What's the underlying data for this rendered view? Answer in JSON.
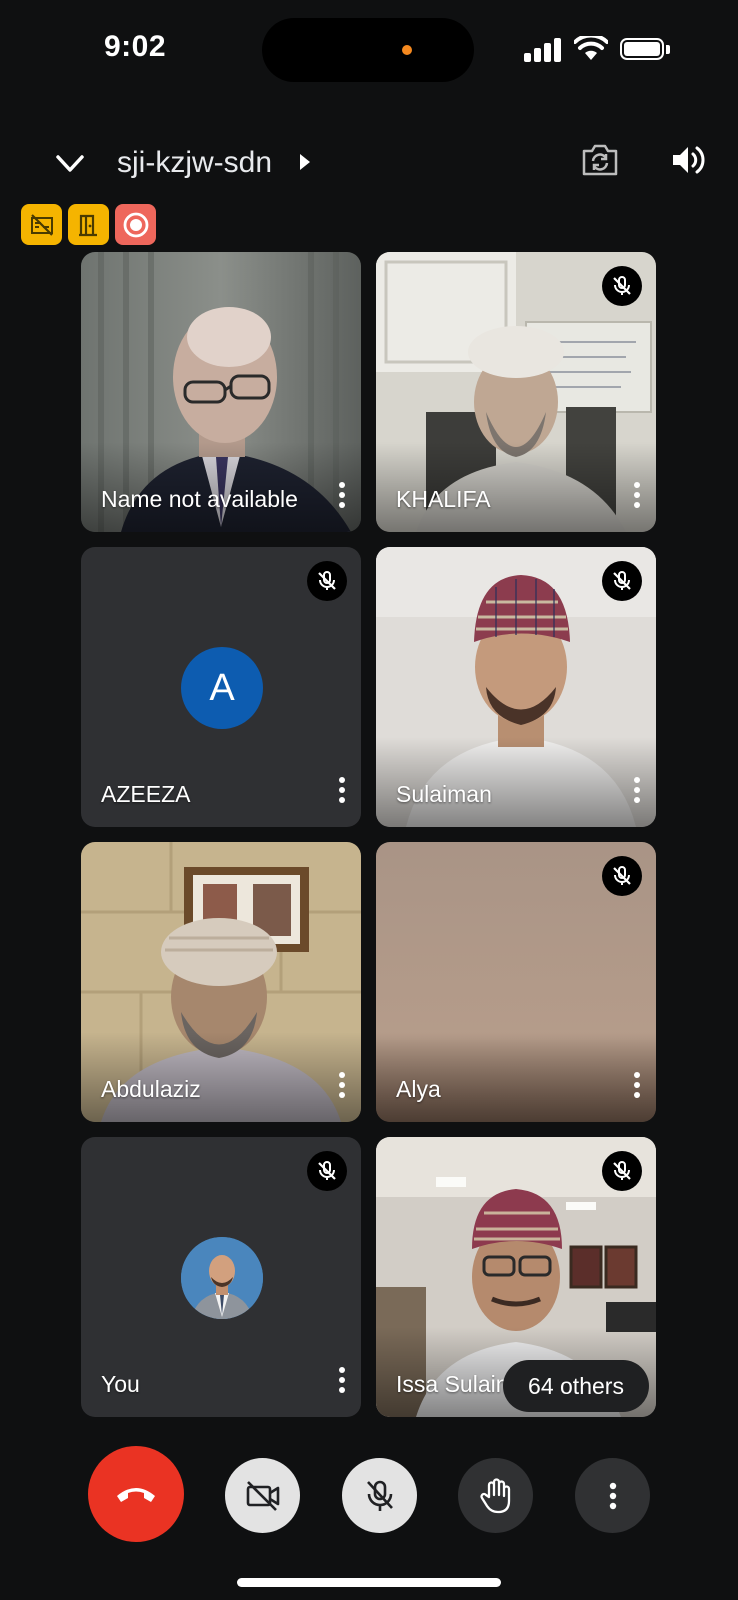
{
  "status_bar": {
    "time": "9:02"
  },
  "meeting": {
    "code": "sji-kzjw-sdn"
  },
  "participants": [
    {
      "name": "Name not available",
      "muted": false
    },
    {
      "name": "KHALIFA",
      "muted": true
    },
    {
      "name": "AZEEZA",
      "muted": true,
      "avatar_letter": "A"
    },
    {
      "name": "Sulaiman",
      "muted": true
    },
    {
      "name": "Abdulaziz",
      "muted": false
    },
    {
      "name": "Alya",
      "muted": true
    },
    {
      "name": "You",
      "muted": true
    },
    {
      "name": "Issa Sulaiman",
      "muted": true
    }
  ],
  "others_chip": "64 others",
  "colors": {
    "end_call": "#ea3323",
    "badge_yellow": "#f5b400",
    "badge_red": "#ee675c",
    "avatar_blue": "#0d5cb0",
    "island_dot": "#f5891f"
  },
  "icons": {
    "badges": [
      "no-captions-icon",
      "door-exit-icon",
      "record-icon"
    ],
    "controls": [
      "end-call-icon",
      "camera-off-icon",
      "mic-off-icon",
      "raise-hand-icon",
      "more-vertical-icon"
    ]
  }
}
